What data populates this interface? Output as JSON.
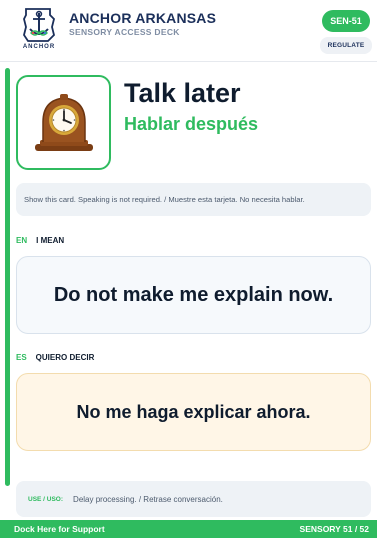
{
  "header": {
    "brand": "ANCHOR ARKANSAS",
    "deck": "SENSORY ACCESS DECK",
    "logo_text": "ANCHOR",
    "code": "SEN-51",
    "category": "REGULATE"
  },
  "phrase": {
    "image_icon": "mantel-clock-icon",
    "title_en": "Talk later",
    "title_es": "Hablar después"
  },
  "instruction": "Show this card. Speaking is not required. / Muestre esta tarjeta. No necesita hablar.",
  "english": {
    "code": "EN",
    "label": "I MEAN",
    "text": "Do not make me explain now."
  },
  "spanish": {
    "code": "ES",
    "label": "QUIERO DECIR",
    "text": "No me haga explicar ahora."
  },
  "use": {
    "label": "USE / USO:",
    "text": "Delay processing. / Retrase conversación."
  },
  "footer": {
    "left": "Dock Here for Support",
    "right": "SENSORY 51 / 52"
  },
  "colors": {
    "accent": "#2fbb5f",
    "navy": "#1b2f5a",
    "spanish_box": "#fff6e7"
  }
}
